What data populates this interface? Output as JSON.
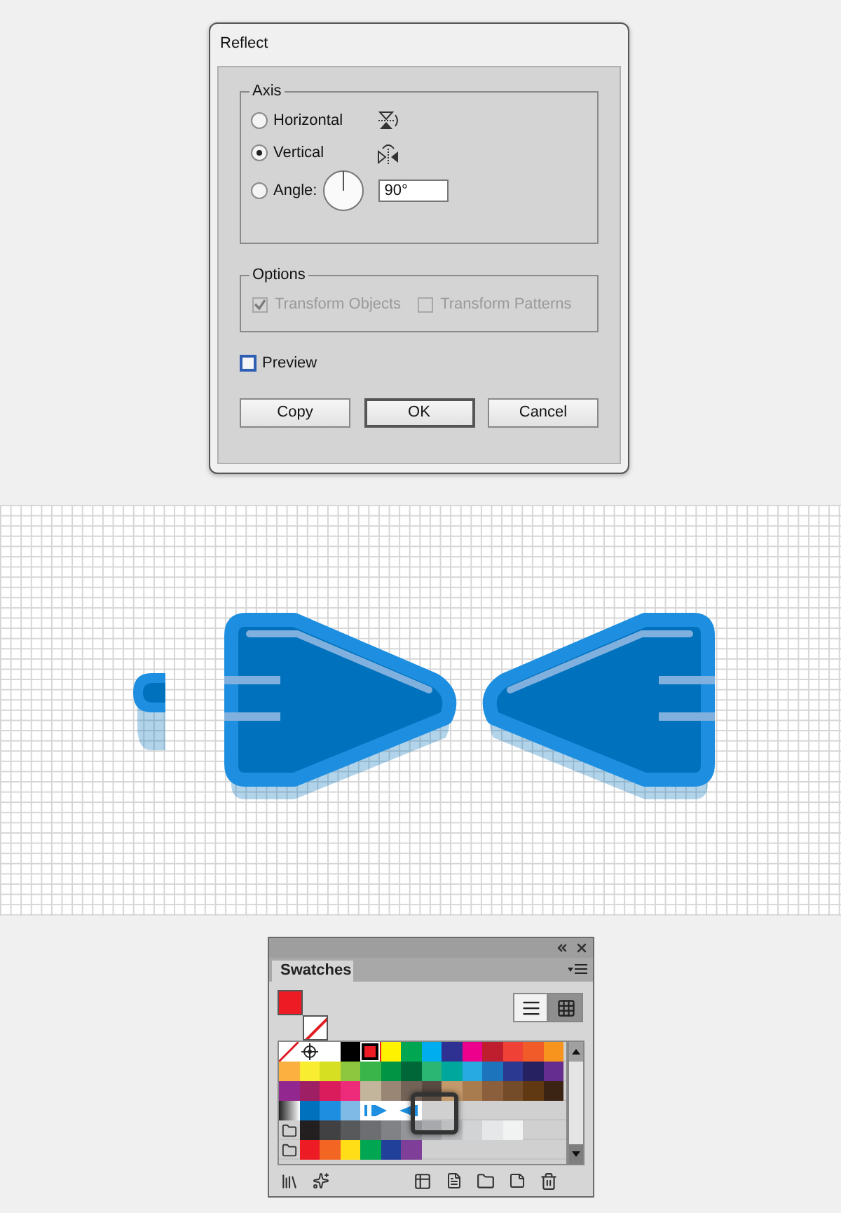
{
  "dialog": {
    "title": "Reflect",
    "axis": {
      "legend": "Axis",
      "angle_value": "90°",
      "options": [
        {
          "label": "Horizontal",
          "kind": "horizontal",
          "selected": false
        },
        {
          "label": "Vertical",
          "kind": "vertical",
          "selected": true
        },
        {
          "label": "Angle:",
          "kind": "angle",
          "selected": false
        }
      ]
    },
    "options": {
      "legend": "Options",
      "disabled": true,
      "items": [
        {
          "label": "Transform Objects",
          "checked": true
        },
        {
          "label": "Transform Patterns",
          "checked": false
        }
      ]
    },
    "preview": {
      "label": "Preview",
      "checked": false
    },
    "buttons": [
      {
        "label": "Copy",
        "default": false
      },
      {
        "label": "OK",
        "default": true
      },
      {
        "label": "Cancel",
        "default": false
      }
    ]
  },
  "swatches_panel": {
    "tab": "Swatches",
    "views": [
      {
        "kind": "list",
        "selected": false
      },
      {
        "kind": "grid",
        "selected": true
      }
    ],
    "rows": [
      {
        "folder": false,
        "swatches": [
          {
            "kind": "none",
            "selected": false
          },
          {
            "kind": "registration",
            "selected": false
          },
          {
            "kind": "color",
            "color": "#ffffff",
            "selected": false
          },
          {
            "kind": "color",
            "color": "#000000",
            "selected": false
          },
          {
            "kind": "color",
            "color": "#ed1c24",
            "selected": true
          },
          {
            "kind": "color",
            "color": "#fff200",
            "selected": false
          },
          {
            "kind": "color",
            "color": "#00a651",
            "selected": false
          },
          {
            "kind": "color",
            "color": "#00aeef",
            "selected": false
          },
          {
            "kind": "color",
            "color": "#2e3192",
            "selected": false
          },
          {
            "kind": "color",
            "color": "#ec008c",
            "selected": false
          },
          {
            "kind": "color",
            "color": "#be1e2d",
            "selected": false
          },
          {
            "kind": "color",
            "color": "#ef4136",
            "selected": false
          },
          {
            "kind": "color",
            "color": "#f15a29",
            "selected": false
          },
          {
            "kind": "color",
            "color": "#f7941d",
            "selected": false
          }
        ]
      },
      {
        "folder": false,
        "swatches": [
          {
            "kind": "color",
            "color": "#fbb040",
            "selected": false
          },
          {
            "kind": "color",
            "color": "#f9ed32",
            "selected": false
          },
          {
            "kind": "color",
            "color": "#d7df23",
            "selected": false
          },
          {
            "kind": "color",
            "color": "#8dc63f",
            "selected": false
          },
          {
            "kind": "color",
            "color": "#39b54a",
            "selected": false
          },
          {
            "kind": "color",
            "color": "#009444",
            "selected": false
          },
          {
            "kind": "color",
            "color": "#006838",
            "selected": false
          },
          {
            "kind": "color",
            "color": "#2bb673",
            "selected": false
          },
          {
            "kind": "color",
            "color": "#00a79d",
            "selected": false
          },
          {
            "kind": "color",
            "color": "#27aae1",
            "selected": false
          },
          {
            "kind": "color",
            "color": "#1c75bc",
            "selected": false
          },
          {
            "kind": "color",
            "color": "#2b3990",
            "selected": false
          },
          {
            "kind": "color",
            "color": "#262262",
            "selected": false
          },
          {
            "kind": "color",
            "color": "#662d91",
            "selected": false
          }
        ]
      },
      {
        "folder": false,
        "swatches": [
          {
            "kind": "color",
            "color": "#92278f",
            "selected": false
          },
          {
            "kind": "color",
            "color": "#9e1f63",
            "selected": false
          },
          {
            "kind": "color",
            "color": "#da1c5c",
            "selected": false
          },
          {
            "kind": "color",
            "color": "#ee2a7b",
            "selected": false
          },
          {
            "kind": "color",
            "color": "#c2b59b",
            "selected": false
          },
          {
            "kind": "color",
            "color": "#998675",
            "selected": false
          },
          {
            "kind": "color",
            "color": "#736357",
            "selected": false
          },
          {
            "kind": "color",
            "color": "#594a42",
            "selected": false
          },
          {
            "kind": "color",
            "color": "#c49a6c",
            "selected": false
          },
          {
            "kind": "color",
            "color": "#a97c50",
            "selected": false
          },
          {
            "kind": "color",
            "color": "#8b5e3c",
            "selected": false
          },
          {
            "kind": "color",
            "color": "#754c29",
            "selected": false
          },
          {
            "kind": "color",
            "color": "#603913",
            "selected": false
          },
          {
            "kind": "color",
            "color": "#3c2415",
            "selected": false
          }
        ]
      },
      {
        "folder": false,
        "swatches": [
          {
            "kind": "gradient",
            "selected": false
          },
          {
            "kind": "color",
            "color": "#0071bc",
            "selected": false
          },
          {
            "kind": "color",
            "color": "#1e8fe0",
            "selected": false
          },
          {
            "kind": "color",
            "color": "#7fb9e6",
            "selected": false
          },
          {
            "kind": "pattern",
            "selected": false
          },
          {
            "kind": "pattern",
            "selected": false
          }
        ]
      },
      {
        "folder": true,
        "swatches": [
          {
            "kind": "color",
            "color": "#231f20",
            "selected": false
          },
          {
            "kind": "color",
            "color": "#414042",
            "selected": false
          },
          {
            "kind": "color",
            "color": "#58595b",
            "selected": false
          },
          {
            "kind": "color",
            "color": "#6d6e71",
            "selected": false
          },
          {
            "kind": "color",
            "color": "#808285",
            "selected": false
          },
          {
            "kind": "color",
            "color": "#939598",
            "selected": false
          },
          {
            "kind": "color",
            "color": "#a7a9ac",
            "selected": false
          },
          {
            "kind": "color",
            "color": "#bcbec0",
            "selected": false
          },
          {
            "kind": "color",
            "color": "#d1d3d4",
            "selected": false
          },
          {
            "kind": "color",
            "color": "#e6e7e8",
            "selected": false
          },
          {
            "kind": "color",
            "color": "#f1f2f2",
            "selected": false
          }
        ]
      },
      {
        "folder": true,
        "swatches": [
          {
            "kind": "color",
            "color": "#ed1c24",
            "selected": false
          },
          {
            "kind": "color",
            "color": "#f26522",
            "selected": false
          },
          {
            "kind": "color",
            "color": "#ffde17",
            "selected": false
          },
          {
            "kind": "color",
            "color": "#00a651",
            "selected": false
          },
          {
            "kind": "color",
            "color": "#21409a",
            "selected": false
          },
          {
            "kind": "color",
            "color": "#7f3f98",
            "selected": false
          }
        ]
      }
    ]
  }
}
